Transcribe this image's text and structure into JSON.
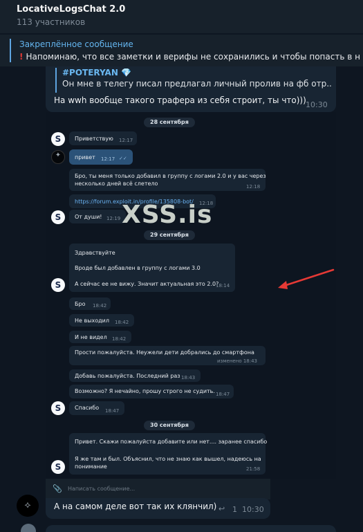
{
  "header": {
    "title": "LocativeLogsChat 2.0",
    "members": "113 участников"
  },
  "pinned": {
    "title": "Закреплённое сообщение",
    "icon": "exclamation-icon",
    "text": "Напоминаю, что все заметки и верифы не сохранились и чтобы попасть в н"
  },
  "outer_message": {
    "quote_author": "#POTERYAN",
    "quote_author_icon": "gem-icon",
    "quote_text": "Он мне в телегу писал предлагал личный пролив на фб отр...",
    "text": "На wwh вообще такого трафера из себя строит, ты что)))",
    "time": "10:30"
  },
  "screenshot": {
    "watermark": "XSS.is",
    "dates": [
      "28 сентября",
      "29 сентября",
      "30 сентября"
    ],
    "messages": [
      {
        "text": "Приветствую",
        "time": "12:17"
      },
      {
        "text": "привет",
        "time": "12:17",
        "read": "✓✓"
      },
      {
        "lines": [
          "Бро, ты меня только добавил в группу с логами 2.0 и у вас через",
          "несколько дней всё слетело"
        ],
        "time": "12:18"
      },
      {
        "text": "https://forum.exploit.in/profile/135808-bot/",
        "time": "12:18"
      },
      {
        "text": "От души!",
        "time": "12:19"
      },
      {
        "lines": [
          "Здравствуйте",
          "Вроде был добавлен в группу с логами 3.0",
          "А сейчас ее не вижу. Значит актуальная это 2.0?"
        ],
        "time": "18:14"
      },
      {
        "text": "Бро",
        "time": "18:42"
      },
      {
        "text": "Не выходил",
        "time": "18:42"
      },
      {
        "text": "И не видел",
        "time": "18:42"
      },
      {
        "text": "Прости пожалуйста. Неужели дети добрались до смартфона",
        "time": "изменено 18:43"
      },
      {
        "text": "Добавь пожалуйста. Последний раз",
        "time": "18:43"
      },
      {
        "text": "Возможно? Я нечайно, прошу строго не судить.",
        "time": "18:47"
      },
      {
        "text": "Спасибо",
        "time": "18:47"
      },
      {
        "lines": [
          "Привет. Скажи пожалуйста добавите или нет.... заранее спасибо",
          "Я же там и был. Объяснил, что не знаю как вышел, надеюсь на",
          "понимание"
        ],
        "time": "21:58"
      }
    ]
  },
  "composer": {
    "placeholder": "Написать сообщение...",
    "attach_icon": "paperclip-icon"
  },
  "bottom_message": {
    "text": "А на самом деле вот так их клянчил)",
    "reply_icon": "reply-icon",
    "reply_count": "1",
    "time": "10:30"
  }
}
